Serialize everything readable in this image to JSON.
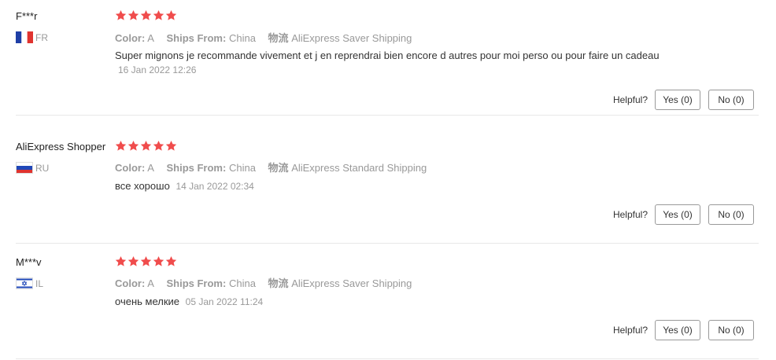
{
  "helpful_label": "Helpful?",
  "reviews": [
    {
      "user": "F***r",
      "country": "FR",
      "flag_icon": "france-flag-icon",
      "stars": 5,
      "color_label": "Color:",
      "color_value": "A",
      "ships_label": "Ships From:",
      "ships_value": "China",
      "logistics_label": "物流",
      "logistics_value": "AliExpress Saver Shipping",
      "text": "Super mignons je recommande vivement et j en reprendrai bien encore d autres pour moi perso ou pour faire un cadeau",
      "date": "16 Jan 2022 12:26",
      "yes": "Yes (0)",
      "no": "No (0)"
    },
    {
      "user": "AliExpress Shopper",
      "country": "RU",
      "flag_icon": "russia-flag-icon",
      "stars": 5,
      "color_label": "Color:",
      "color_value": "A",
      "ships_label": "Ships From:",
      "ships_value": "China",
      "logistics_label": "物流",
      "logistics_value": "AliExpress Standard Shipping",
      "text": "все хорошо",
      "date": "14 Jan 2022 02:34",
      "yes": "Yes (0)",
      "no": "No (0)"
    },
    {
      "user": "M***v",
      "country": "IL",
      "flag_icon": "israel-flag-icon",
      "stars": 5,
      "color_label": "Color:",
      "color_value": "A",
      "ships_label": "Ships From:",
      "ships_value": "China",
      "logistics_label": "物流",
      "logistics_value": "AliExpress Saver Shipping",
      "text": "очень мелкие",
      "date": "05 Jan 2022 11:24",
      "yes": "Yes (0)",
      "no": "No (0)"
    }
  ],
  "colors": {
    "star": "#f04c4c",
    "muted": "#999999",
    "divider": "#e8e8e8"
  }
}
